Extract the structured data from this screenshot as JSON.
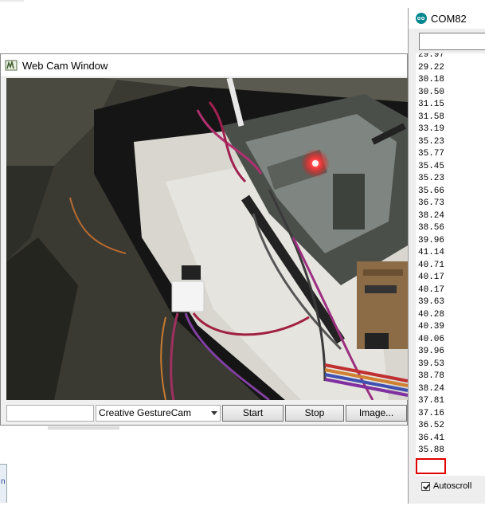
{
  "webcam_window": {
    "title": "Web Cam Window",
    "camera_select": "Creative GestureCam",
    "buttons": {
      "start": "Start",
      "stop": "Stop",
      "image": "Image..."
    }
  },
  "serial_monitor": {
    "title": "COM82",
    "readings": [
      "29.97",
      "29.22",
      "30.18",
      "30.50",
      "31.15",
      "31.58",
      "33.19",
      "35.23",
      "35.77",
      "35.45",
      "35.23",
      "35.66",
      "36.73",
      "38.24",
      "38.56",
      "39.96",
      "41.14",
      "40.71",
      "40.17",
      "40.17",
      "39.63",
      "40.28",
      "40.39",
      "40.06",
      "39.96",
      "39.53",
      "38.78",
      "38.24",
      "37.81",
      "37.16",
      "36.52",
      "36.41",
      "35.88"
    ],
    "highlighted_reading": "35.88",
    "autoscroll_label": "Autoscroll",
    "autoscroll_checked": true
  },
  "background": {
    "left_fragment_text": "n"
  },
  "colors": {
    "arduino_teal": "#00878f",
    "highlight_red": "#e00000",
    "led_red": "#ff3030"
  }
}
